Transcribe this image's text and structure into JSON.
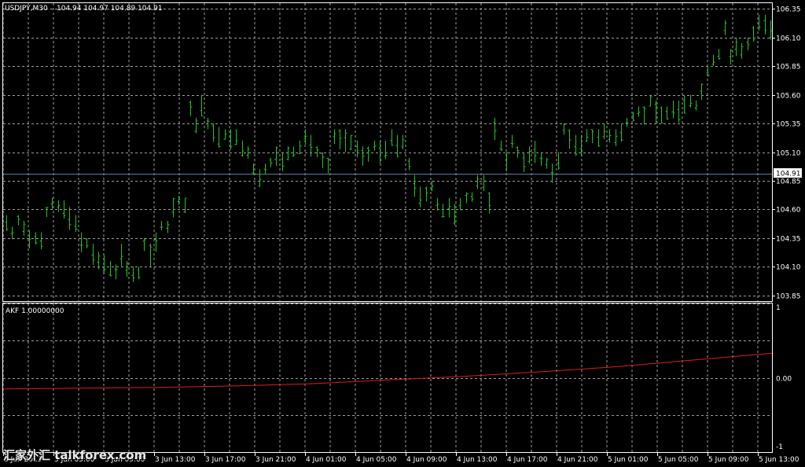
{
  "window": {
    "symbol_header": "USDJPY,M30",
    "ohlc_text": "104.94 104.97 104.89 104.91"
  },
  "colors": {
    "background": "#000000",
    "grid": "#9e9e9e",
    "bull_bar": "#22c322",
    "indicator_line": "#dd1c1c",
    "bid_line": "#5d7aa1",
    "axis_text": "#ffffff",
    "panel_border": "#ffffff"
  },
  "price_panel": {
    "y_ticks": [
      "106.35",
      "106.10",
      "105.85",
      "105.60",
      "105.35",
      "105.10",
      "104.85",
      "104.60",
      "104.35",
      "104.10",
      "103.85"
    ],
    "current_price_label": "104.91"
  },
  "indicator_panel": {
    "label": "AKF 1.00000000",
    "y_ticks": [
      "1",
      "0.00",
      "-1"
    ]
  },
  "x_axis": {
    "labels": [
      "3 Jun 2013",
      "3 Jun 05:00",
      "3 Jun 09:00",
      "3 Jun 13:00",
      "3 Jun 17:00",
      "3 Jun 21:00",
      "4 Jun 01:00",
      "4 Jun 05:00",
      "4 Jun 09:00",
      "4 Jun 13:00",
      "4 Jun 17:00",
      "4 Jun 21:00",
      "5 Jun 01:00",
      "5 Jun 05:00",
      "5 Jun 09:00",
      "5 Jun 13:00"
    ]
  },
  "watermark": {
    "text": "汇家外汇 talkforex.com"
  },
  "chart_data": [
    {
      "type": "line",
      "title": "USDJPY,M30",
      "style": "ohlc-bars",
      "ylim": [
        103.8,
        106.4
      ],
      "grid": true,
      "highs": [
        104.55,
        104.45,
        104.55,
        104.5,
        104.42,
        104.4,
        104.4,
        104.62,
        104.7,
        104.68,
        104.68,
        104.62,
        104.55,
        104.4,
        104.35,
        104.3,
        104.23,
        104.2,
        104.15,
        104.12,
        104.3,
        104.15,
        104.1,
        104.1,
        104.35,
        104.3,
        104.4,
        104.5,
        104.5,
        104.7,
        104.72,
        104.7,
        105.55,
        105.4,
        105.6,
        105.4,
        105.35,
        105.32,
        105.3,
        105.3,
        105.3,
        105.2,
        105.15,
        105.0,
        104.95,
        105.0,
        105.05,
        105.15,
        105.1,
        105.15,
        105.15,
        105.2,
        105.3,
        105.25,
        105.15,
        105.1,
        105.05,
        105.3,
        105.3,
        105.3,
        105.25,
        105.2,
        105.15,
        105.15,
        105.2,
        105.2,
        105.2,
        105.3,
        105.25,
        105.25,
        105.05,
        104.9,
        104.8,
        104.8,
        104.85,
        104.7,
        104.65,
        104.7,
        104.65,
        104.7,
        104.75,
        104.75,
        104.9,
        104.9,
        104.75,
        105.4,
        105.2,
        105.1,
        105.25,
        105.15,
        105.1,
        105.15,
        105.2,
        105.1,
        105.05,
        105.0,
        105.1,
        105.35,
        105.3,
        105.25,
        105.25,
        105.3,
        105.3,
        105.3,
        105.35,
        105.3,
        105.3,
        105.35,
        105.4,
        105.45,
        105.5,
        105.5,
        105.6,
        105.55,
        105.5,
        105.5,
        105.55,
        105.55,
        105.6,
        105.6,
        105.55,
        105.7,
        105.85,
        105.95,
        106.0,
        106.25,
        106.0,
        106.1,
        106.05,
        106.1,
        106.2,
        106.3,
        106.3,
        106.25
      ]
    },
    {
      "type": "line",
      "title": "AKF 1.00000000",
      "ylim": [
        -1,
        1
      ],
      "ticks": [
        1,
        0,
        -1
      ],
      "x": [
        0,
        0.1,
        0.2,
        0.3,
        0.4,
        0.5,
        0.6,
        0.7,
        0.8,
        0.9,
        1.0
      ],
      "values": [
        -0.15,
        -0.14,
        -0.13,
        -0.11,
        -0.08,
        -0.03,
        0.02,
        0.08,
        0.15,
        0.24,
        0.33
      ]
    }
  ]
}
